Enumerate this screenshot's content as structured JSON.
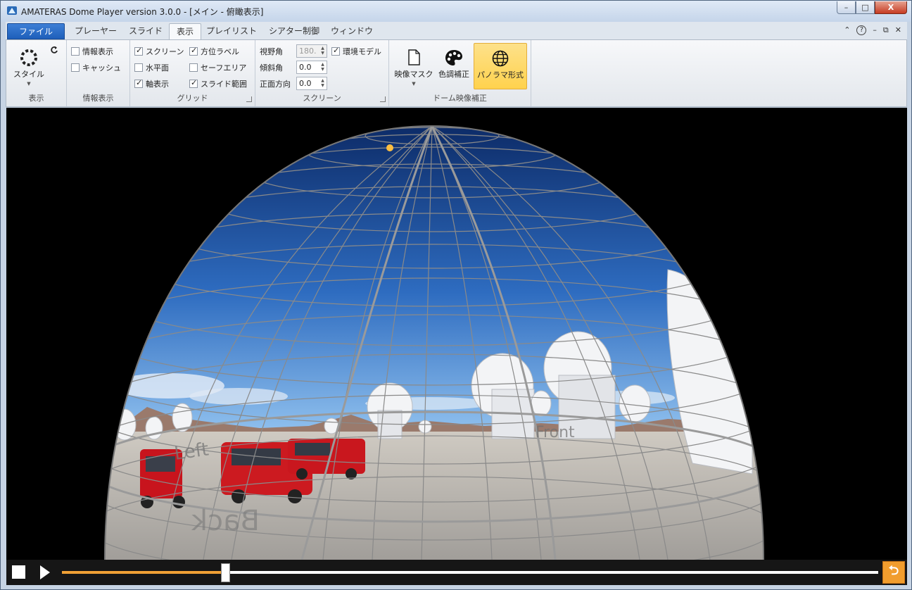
{
  "window": {
    "title": "AMATERAS Dome Player version 3.0.0 - [メイン - 俯瞰表示]",
    "controls": {
      "minimize": "–",
      "maximize": "□",
      "close": "X"
    }
  },
  "tabs": [
    {
      "label": "ファイル"
    },
    {
      "label": "プレーヤー"
    },
    {
      "label": "スライド"
    },
    {
      "label": "表示",
      "active": true
    },
    {
      "label": "プレイリスト"
    },
    {
      "label": "シアター制御"
    },
    {
      "label": "ウィンドウ"
    }
  ],
  "tabbar_right": {
    "collapse": "⌃",
    "help": "?",
    "minimize": "–",
    "restore": "⧉",
    "close": "✕"
  },
  "ribbon": {
    "view_group": {
      "label": "表示",
      "style_button": "スタイル"
    },
    "info_group": {
      "label": "情報表示",
      "items": [
        {
          "label": "情報表示",
          "checked": false
        },
        {
          "label": "キャッシュ",
          "checked": false
        }
      ]
    },
    "grid_group": {
      "label": "グリッド",
      "items": [
        {
          "label": "スクリーン",
          "checked": true
        },
        {
          "label": "水平面",
          "checked": false
        },
        {
          "label": "軸表示",
          "checked": true
        },
        {
          "label": "方位ラベル",
          "checked": true
        },
        {
          "label": "セーフエリア",
          "checked": false
        },
        {
          "label": "スライド範囲",
          "checked": true
        }
      ]
    },
    "screen_group": {
      "label": "スクリーン",
      "fields": [
        {
          "label": "視野角",
          "value": "180.",
          "disabled": true
        },
        {
          "label": "傾斜角",
          "value": "0.0"
        },
        {
          "label": "正面方向",
          "value": "0.0"
        }
      ],
      "env_model": {
        "label": "環境モデル",
        "checked": true
      }
    },
    "dome_group": {
      "label": "ドーム映像補正",
      "buttons": [
        {
          "label": "映像マスク"
        },
        {
          "label": "色調補正"
        },
        {
          "label": "パノラマ形式",
          "active": true
        }
      ]
    }
  },
  "viewport": {
    "direction_labels": {
      "left": "Left",
      "front": "Front",
      "back": "Back"
    },
    "colors": {
      "sky_top": "#0c2a66",
      "sky_bottom": "#4f8fd8",
      "ground": "#b9b7b2",
      "grid": "#8a8a8a"
    }
  },
  "player": {
    "progress": 0.2,
    "loop_icon": "⮌"
  }
}
